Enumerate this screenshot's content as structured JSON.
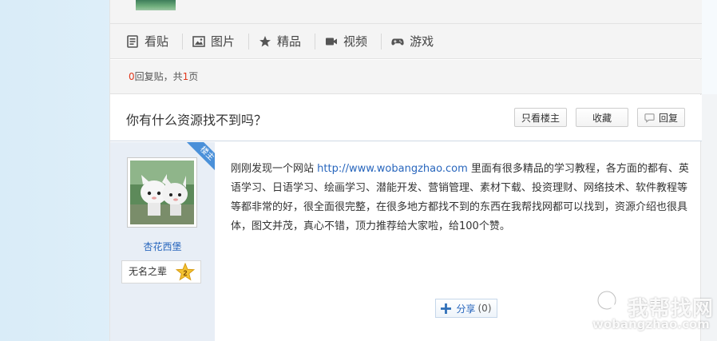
{
  "nav": {
    "items": [
      {
        "label": "看贴",
        "icon": "document-icon"
      },
      {
        "label": "图片",
        "icon": "image-icon"
      },
      {
        "label": "精品",
        "icon": "star-icon"
      },
      {
        "label": "视频",
        "icon": "video-icon"
      },
      {
        "label": "游戏",
        "icon": "gamepad-icon"
      }
    ]
  },
  "reply_info": {
    "reply_count": "0",
    "text_reply": "回复贴，共",
    "page_count": "1",
    "text_page": "页"
  },
  "thread": {
    "title": "你有什么资源找不到吗？",
    "buttons": {
      "only_op": "只看楼主",
      "favorite": "收藏",
      "reply": "回复"
    }
  },
  "post": {
    "badge": "楼主",
    "author": "杏花西堡",
    "rank_title": "无名之辈",
    "rank_level": "2",
    "content_before": "刚刚发现一个网站 ",
    "link": "http://www.wobangzhao.com",
    "content_after": " 里面有很多精品的学习教程，各方面的都有、英语学习、日语学习、绘画学习、潜能开发、营销管理、素材下载、投资理财、网络技术、软件教程等等都非常的好，很全面很完整，在很多地方都找不到的东西在我帮找网都可以找到，资源介绍也很具体，图文并茂，真心不错，顶力推荐给大家啦，给100个赞。",
    "share_label": "分享",
    "share_count": "(0)"
  },
  "watermark": {
    "name": "我帮找网",
    "url": "wobangzhao.com"
  },
  "colors": {
    "link": "#2866bd",
    "red": "#e0371c",
    "badge": "#4a90d9"
  }
}
